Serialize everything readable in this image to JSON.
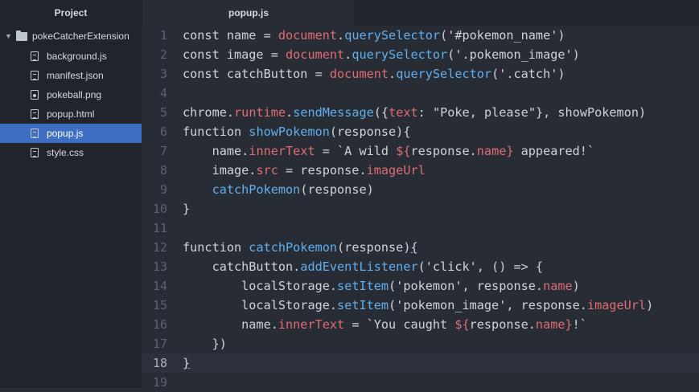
{
  "sidebar": {
    "header": "Project",
    "root": "pokeCatcherExtension",
    "files": [
      {
        "name": "background.js",
        "icon": "file-icon",
        "selected": false
      },
      {
        "name": "manifest.json",
        "icon": "file-icon",
        "selected": false
      },
      {
        "name": "pokeball.png",
        "icon": "image-file-icon",
        "selected": false
      },
      {
        "name": "popup.html",
        "icon": "file-icon",
        "selected": false
      },
      {
        "name": "popup.js",
        "icon": "file-icon",
        "selected": true
      },
      {
        "name": "style.css",
        "icon": "file-icon",
        "selected": false
      }
    ]
  },
  "editor": {
    "tab_title": "popup.js",
    "cursor_line": 18,
    "lines": [
      [
        [
          "k",
          "const name = "
        ],
        [
          "v",
          "document"
        ],
        [
          "p",
          "."
        ],
        [
          "f",
          "querySelector"
        ],
        [
          "p",
          "('#pokemon_name')"
        ]
      ],
      [
        [
          "k",
          "const image = "
        ],
        [
          "v",
          "document"
        ],
        [
          "p",
          "."
        ],
        [
          "f",
          "querySelector"
        ],
        [
          "p",
          "('.pokemon_image')"
        ]
      ],
      [
        [
          "k",
          "const catchButton = "
        ],
        [
          "v",
          "document"
        ],
        [
          "p",
          "."
        ],
        [
          "f",
          "querySelector"
        ],
        [
          "p",
          "('.catch')"
        ]
      ],
      [],
      [
        [
          "k",
          "chrome"
        ],
        [
          "p",
          "."
        ],
        [
          "v",
          "runtime"
        ],
        [
          "p",
          "."
        ],
        [
          "f",
          "sendMessage"
        ],
        [
          "p",
          "({"
        ],
        [
          "v",
          "text"
        ],
        [
          "p",
          ": \"Poke, please\"}, showPokemon)"
        ]
      ],
      [
        [
          "k",
          "function "
        ],
        [
          "f",
          "showPokemon"
        ],
        [
          "p",
          "(response){"
        ]
      ],
      [
        [
          "p",
          "    name."
        ],
        [
          "v",
          "innerText"
        ],
        [
          "p",
          " = `A wild "
        ],
        [
          "v",
          "${"
        ],
        [
          "p",
          "response."
        ],
        [
          "v",
          "name}"
        ],
        [
          "p",
          " appeared!`"
        ]
      ],
      [
        [
          "p",
          "    image."
        ],
        [
          "v",
          "src"
        ],
        [
          "p",
          " = response."
        ],
        [
          "v",
          "imageUrl"
        ]
      ],
      [
        [
          "p",
          "    "
        ],
        [
          "f",
          "catchPokemon"
        ],
        [
          "p",
          "(response)"
        ]
      ],
      [
        [
          "p",
          "}"
        ]
      ],
      [],
      [
        [
          "k",
          "function "
        ],
        [
          "f",
          "catchPokemon"
        ],
        [
          "p",
          "(response)"
        ],
        [
          "pu",
          "{"
        ]
      ],
      [
        [
          "p",
          "    catchButton."
        ],
        [
          "f",
          "addEventListener"
        ],
        [
          "p",
          "('click', () => {"
        ]
      ],
      [
        [
          "p",
          "        localStorage."
        ],
        [
          "f",
          "setItem"
        ],
        [
          "p",
          "('pokemon', response."
        ],
        [
          "v",
          "name"
        ],
        [
          "p",
          ")"
        ]
      ],
      [
        [
          "p",
          "        localStorage."
        ],
        [
          "f",
          "setItem"
        ],
        [
          "p",
          "('pokemon_image', response."
        ],
        [
          "v",
          "imageUrl"
        ],
        [
          "p",
          ")"
        ]
      ],
      [
        [
          "p",
          "        name."
        ],
        [
          "v",
          "innerText"
        ],
        [
          "p",
          " = `You caught "
        ],
        [
          "v",
          "${"
        ],
        [
          "p",
          "response."
        ],
        [
          "v",
          "name}"
        ],
        [
          "p",
          "!`"
        ]
      ],
      [
        [
          "p",
          "    })"
        ]
      ],
      [
        [
          "pu",
          "}"
        ]
      ],
      []
    ]
  }
}
